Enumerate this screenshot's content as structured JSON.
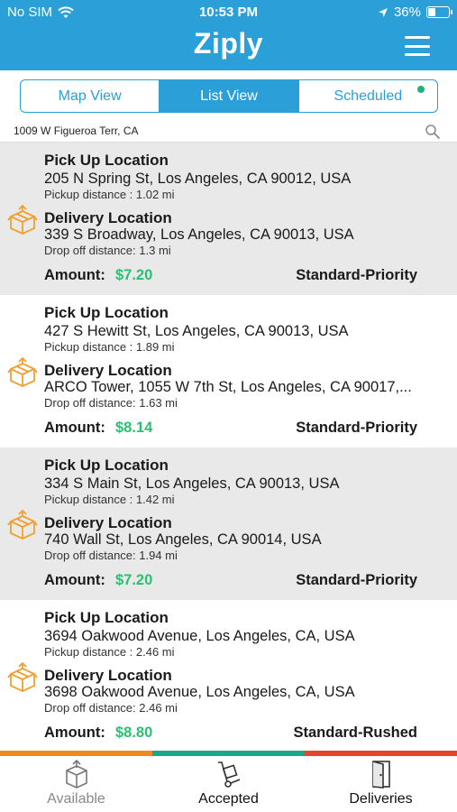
{
  "status_bar": {
    "carrier": "No SIM",
    "time": "10:53 PM",
    "battery": "36%",
    "battery_level": 0.36
  },
  "header": {
    "title": "Ziply"
  },
  "tabs": [
    {
      "label": "Map View",
      "active": false
    },
    {
      "label": "List View",
      "active": true
    },
    {
      "label": "Scheduled",
      "active": false
    }
  ],
  "location": {
    "address": "1009 W Figueroa Terr, CA"
  },
  "orders": [
    {
      "pickup_heading": "Pick Up Location",
      "pickup_address": "205 N Spring St,  Los Angeles,  CA 90012,  USA",
      "pickup_distance": "Pickup distance : 1.02 mi",
      "delivery_heading": "Delivery Location",
      "delivery_address": "339 S Broadway,  Los Angeles,  CA 90013,  USA",
      "dropoff_distance": "Drop off distance: 1.3 mi",
      "amount_label": "Amount:",
      "amount": "$7.20",
      "priority": "Standard-Priority"
    },
    {
      "pickup_heading": "Pick Up Location",
      "pickup_address": "427 S Hewitt St,  Los Angeles,  CA 90013,  USA",
      "pickup_distance": "Pickup distance : 1.89 mi",
      "delivery_heading": "Delivery Location",
      "delivery_address": "ARCO Tower,  1055 W 7th St,  Los Angeles,  CA 90017,...",
      "dropoff_distance": "Drop off distance: 1.63 mi",
      "amount_label": "Amount:",
      "amount": "$8.14",
      "priority": "Standard-Priority"
    },
    {
      "pickup_heading": "Pick Up Location",
      "pickup_address": "334 S Main St,  Los Angeles,  CA 90013,  USA",
      "pickup_distance": "Pickup distance : 1.42 mi",
      "delivery_heading": "Delivery Location",
      "delivery_address": "740 Wall St,  Los Angeles,  CA 90014,  USA",
      "dropoff_distance": "Drop off distance: 1.94 mi",
      "amount_label": "Amount:",
      "amount": "$7.20",
      "priority": "Standard-Priority"
    },
    {
      "pickup_heading": "Pick Up Location",
      "pickup_address": "3694 Oakwood Avenue,  Los Angeles,  CA,  USA",
      "pickup_distance": "Pickup distance : 2.46 mi",
      "delivery_heading": "Delivery Location",
      "delivery_address": "3698 Oakwood Avenue,  Los Angeles,  CA,  USA",
      "dropoff_distance": "Drop off distance: 2.46 mi",
      "amount_label": "Amount:",
      "amount": "$8.80",
      "priority": "Standard-Rushed"
    }
  ],
  "bottom_nav": [
    {
      "label": "Available",
      "icon": "box-icon"
    },
    {
      "label": "Accepted",
      "icon": "hand-truck-icon"
    },
    {
      "label": "Deliveries",
      "icon": "door-icon"
    }
  ],
  "colors": {
    "header": "#2a9fd8",
    "amount": "#2cbf73",
    "box_icon": "#f0a030",
    "scheduled_dot": "#1db47a",
    "bar_orange": "#f08a1e",
    "bar_teal": "#17a98a",
    "bar_red": "#e4462b"
  }
}
